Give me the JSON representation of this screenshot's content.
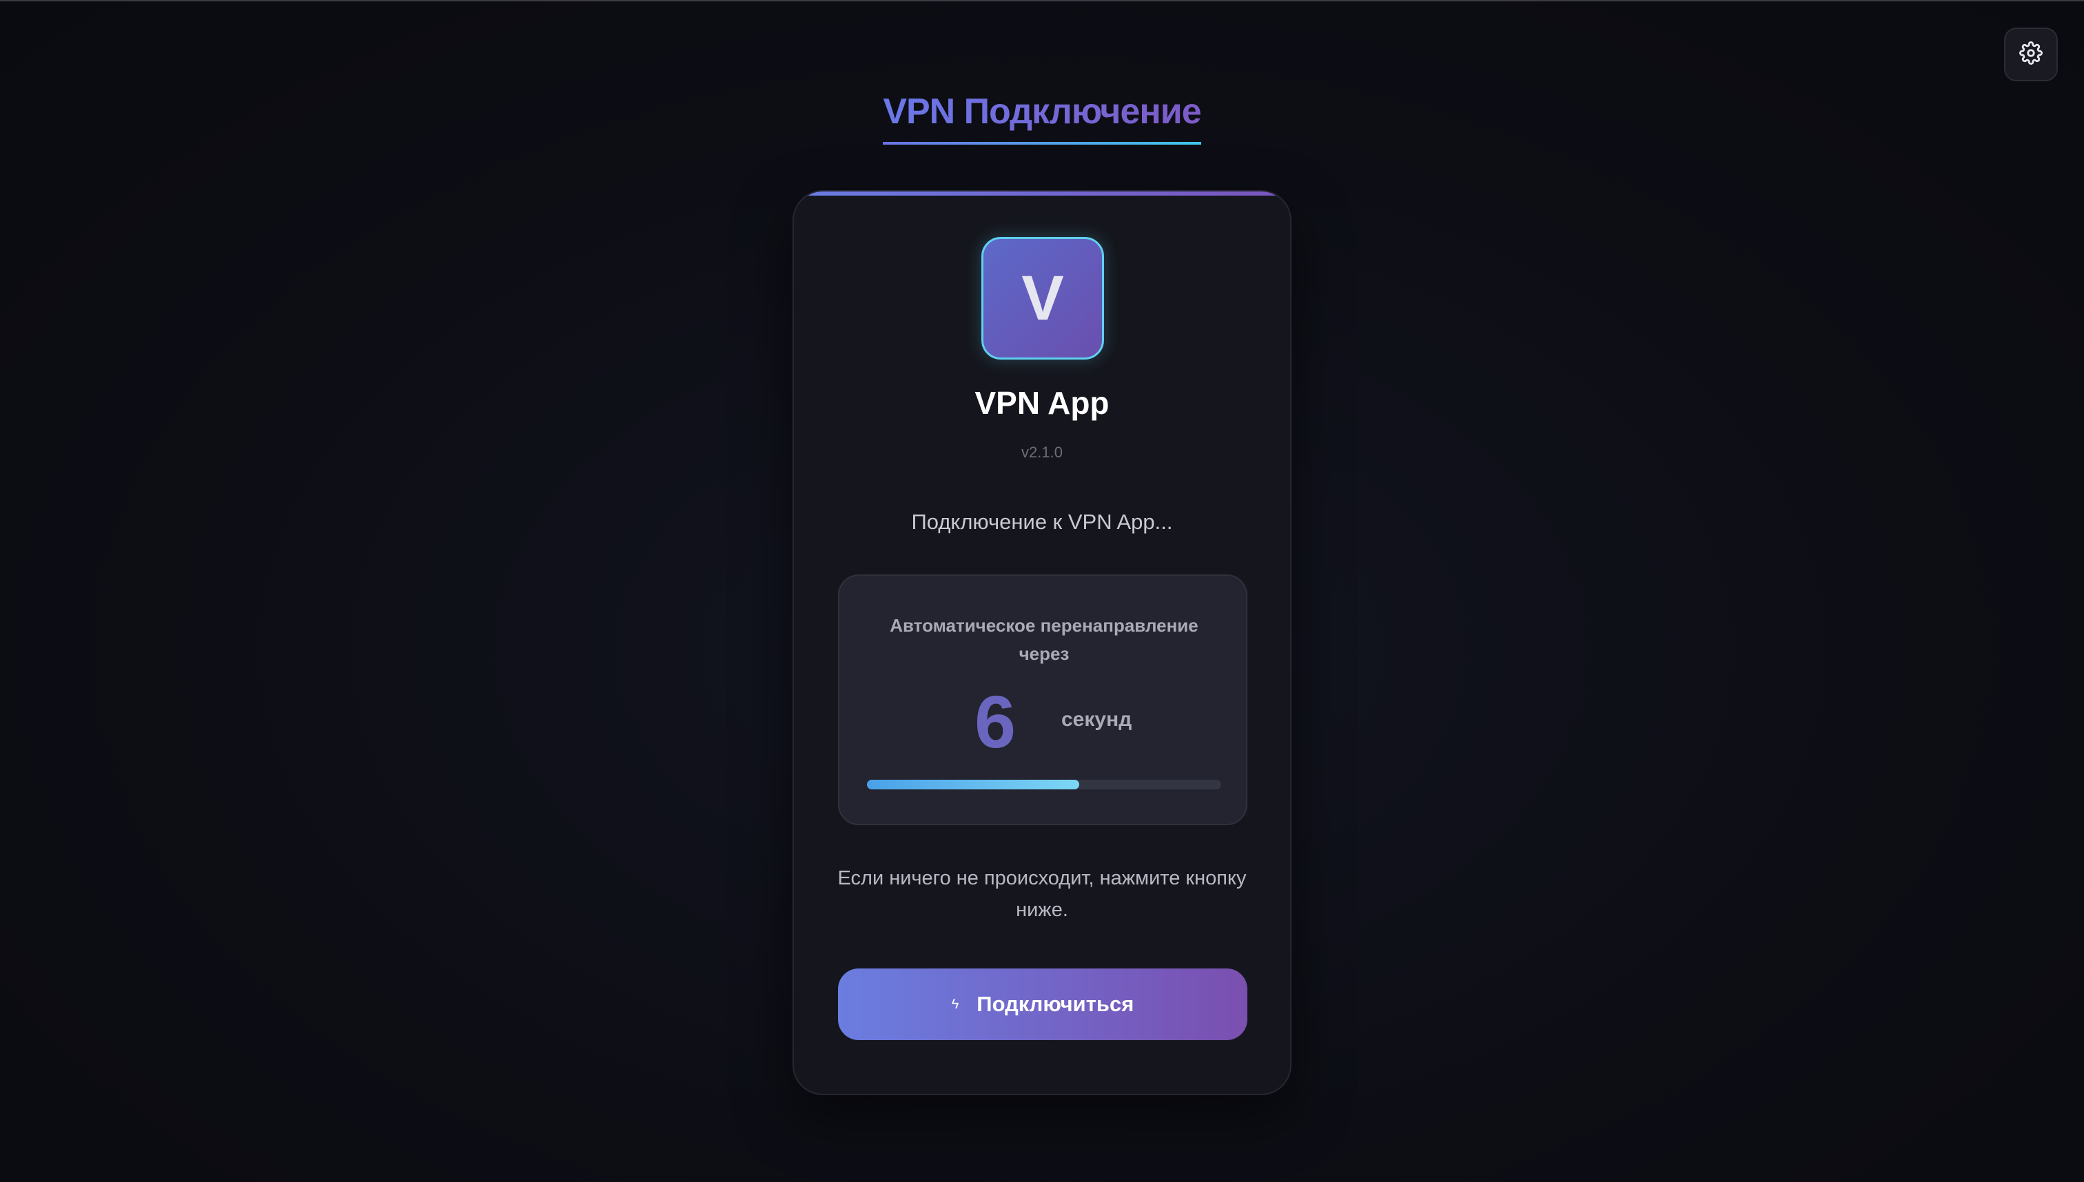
{
  "page": {
    "title": "VPN Подключение"
  },
  "header": {
    "settings_icon": "gear-icon"
  },
  "card": {
    "logo_letter": "V",
    "app_name": "VPN App",
    "version": "v2.1.0",
    "status": "Подключение к VPN App...",
    "redirect": {
      "label": "Автоматическое перенаправление через",
      "countdown": "6",
      "seconds_label": "секунд",
      "progress": 0.6
    },
    "hint": "Если ничего не происходит, нажмите кнопку ниже.",
    "connect_button": {
      "icon": "lightning-icon",
      "label": "Подключиться"
    }
  },
  "colors": {
    "accent_start": "#6b7de6",
    "accent_end": "#7a55c0",
    "progress": "#4aa0e8"
  }
}
